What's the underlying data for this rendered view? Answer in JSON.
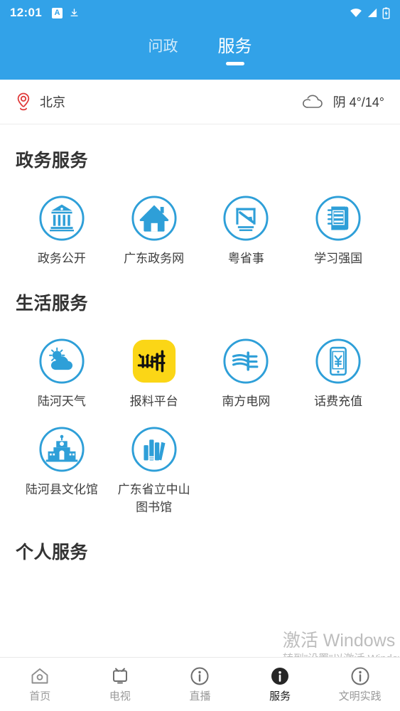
{
  "statusbar": {
    "time": "12:01",
    "app_badge": "A",
    "icons": [
      "download-icon",
      "wifi-icon",
      "signal-icon",
      "battery-charging-icon"
    ]
  },
  "tabs": [
    {
      "label": "问政",
      "active": false
    },
    {
      "label": "服务",
      "active": true
    }
  ],
  "locationbar": {
    "city": "北京",
    "weather": "阴 4°/14°",
    "pin_color": "#E03A3A"
  },
  "theme": {
    "header_blue": "#32A2E8",
    "icon_blue": "#2E9FD8",
    "accent_yellow": "#FBD616"
  },
  "sections": [
    {
      "title": "政务服务",
      "items": [
        {
          "label": "政务公开",
          "icon": "bank-building-icon"
        },
        {
          "label": "广东政务网",
          "icon": "house-icon"
        },
        {
          "label": "粤省事",
          "icon": "yue-character-icon"
        },
        {
          "label": "学习强国",
          "icon": "notebook-icon"
        }
      ]
    },
    {
      "title": "生活服务",
      "items": [
        {
          "label": "陆河天气",
          "icon": "sun-cloud-icon"
        },
        {
          "label": "报料平台",
          "icon": "baoliao-tile-icon"
        },
        {
          "label": "南方电网",
          "icon": "power-grid-icon"
        },
        {
          "label": "话费充值",
          "icon": "phone-yen-icon"
        },
        {
          "label": "陆河县文化馆",
          "icon": "culture-center-icon"
        },
        {
          "label": "广东省立中山\n图书馆",
          "icon": "books-icon"
        }
      ]
    },
    {
      "title": "个人服务",
      "items": []
    }
  ],
  "bottomnav": [
    {
      "label": "首页",
      "icon": "home-icon",
      "active": false
    },
    {
      "label": "电视",
      "icon": "tv-icon",
      "active": false
    },
    {
      "label": "直播",
      "icon": "info-circle-icon",
      "active": false
    },
    {
      "label": "服务",
      "icon": "info-filled-icon",
      "active": true
    },
    {
      "label": "文明实践",
      "icon": "info-circle-icon",
      "active": false
    }
  ],
  "watermark": {
    "line1": "激活 Windows",
    "line2": "转到\"设置\"以激活 Window"
  }
}
